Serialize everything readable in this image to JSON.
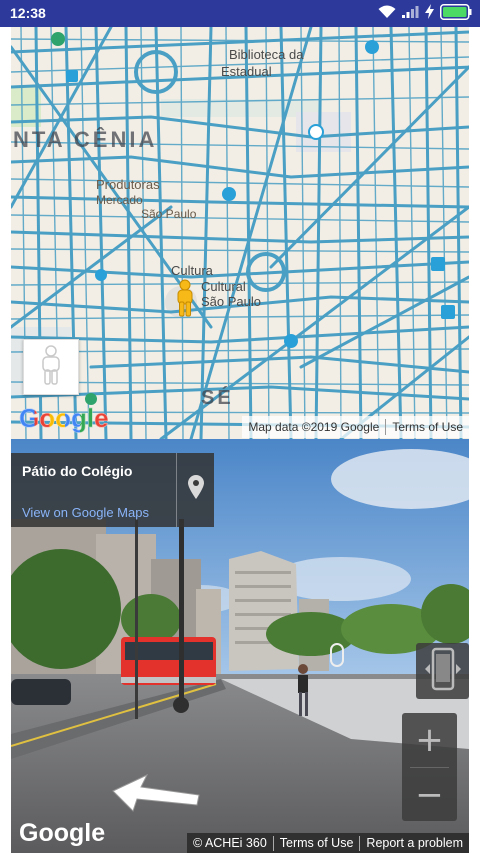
{
  "status_bar": {
    "time": "12:38",
    "icons": [
      "wifi-icon",
      "signal-icon",
      "charging-icon",
      "battery-icon"
    ],
    "background": "#2d3a9c"
  },
  "map": {
    "logo": "Google",
    "labels": {
      "district": "NTA  CÊNIA",
      "se": "SÉ",
      "b1": "Biblioteca da",
      "b2": "Estadual",
      "p1": "Produtoras",
      "p2": "Mercado",
      "p3": "São Paulo",
      "c1": "Cultura",
      "c2": "Cultural",
      "c3": "São Paulo"
    },
    "attribution": {
      "data": "Map data ©2019 Google",
      "terms": "Terms of Use"
    },
    "road_color": "#4a9fc4",
    "background": "#f3efe6"
  },
  "street_view": {
    "place_name": "Pátio do Colégio",
    "view_link": "View on Google Maps",
    "zoom_in": "+",
    "zoom_out": "−",
    "logo": "Google",
    "attribution": {
      "copyright": "© ACHEi 360",
      "terms": "Terms of Use",
      "report": "Report a problem"
    }
  }
}
